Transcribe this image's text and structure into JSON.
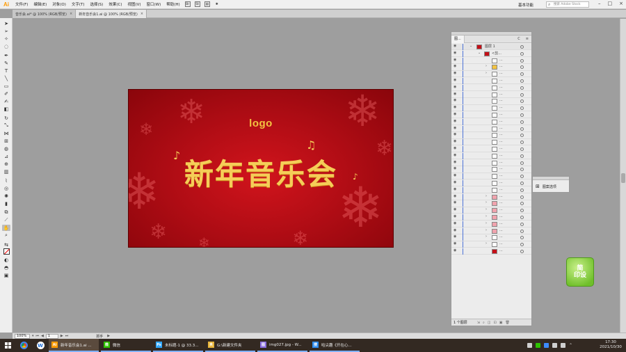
{
  "menubar": {
    "logo": "Ai",
    "items": [
      "文件(F)",
      "编辑(E)",
      "对象(O)",
      "文字(T)",
      "选择(S)",
      "效果(C)",
      "视图(V)",
      "窗口(W)",
      "帮助(H)"
    ],
    "bridge_label": "Br",
    "stock_label": "St",
    "workspace": "基本功能",
    "search_placeholder": "搜索 Adobe Stock"
  },
  "tabs": [
    {
      "label": "音乐会.ai* @ 100% (RGB/预览)",
      "active": false
    },
    {
      "label": "新年音乐会1.ai @ 100% (RGB/预览)",
      "active": true
    }
  ],
  "artboard": {
    "logo_text": "logo",
    "headline": "新年音乐会"
  },
  "layers_panel": {
    "tab_label": "图...",
    "header_btn": "C",
    "root_layer_name": "图层 1",
    "sub_layer_name": "<剪...",
    "child_name": "...",
    "footer_label": "1 个图层"
  },
  "options_panel": {
    "label": "图案选项"
  },
  "sticker": {
    "text": "简\n印设"
  },
  "status": {
    "zoom": "100%",
    "page": "1",
    "tool": "抓手"
  },
  "taskbar": {
    "apps": [
      {
        "icon": "Ai",
        "label": "新年音乐会1.ai ...",
        "active": true,
        "color": "#ff9a00"
      },
      {
        "icon": "微",
        "label": "微信",
        "active": false,
        "color": "#2dc100"
      },
      {
        "icon": "Ps",
        "label": "未标题-1 @ 33.3...",
        "active": false,
        "color": "#31a8ff"
      },
      {
        "icon": "夹",
        "label": "G:\\新建文件夹",
        "active": false,
        "color": "#e8b53a"
      },
      {
        "icon": "图",
        "label": "img027.jpg - W...",
        "active": false,
        "color": "#8a6de0"
      },
      {
        "icon": "搜",
        "label": "哈尖趣《开在心...",
        "active": false,
        "color": "#2d8cf0"
      }
    ],
    "time": "17:30",
    "date": "2021/10/30"
  }
}
